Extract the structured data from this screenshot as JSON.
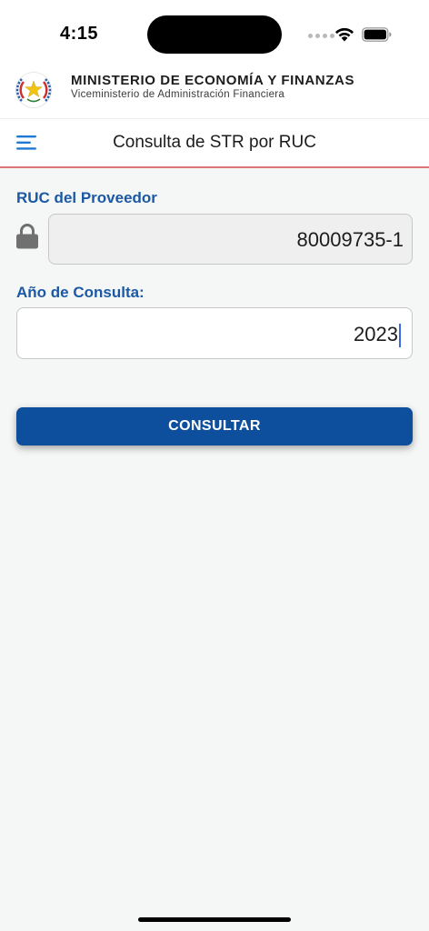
{
  "status_bar": {
    "time": "4:15",
    "icons": [
      "signal-icon",
      "wifi-icon",
      "battery-icon"
    ]
  },
  "header": {
    "logo": "seal-icon",
    "title": "MINISTERIO DE ECONOMÍA Y FINANZAS",
    "subtitle": "Viceministerio de Administración Financiera"
  },
  "nav": {
    "menu_icon": "menu-icon",
    "title": "Consulta de STR por RUC"
  },
  "form": {
    "ruc_label": "RUC del Proveedor",
    "ruc_value": "80009735-1",
    "ruc_locked": true,
    "lock_icon": "lock-icon",
    "anio_label": "Año de Consulta:",
    "anio_value": "2023",
    "submit_label": "CONSULTAR"
  },
  "colors": {
    "accent_blue": "#1b59a5",
    "button_blue": "#0d4f9d",
    "nav_divider": "#d9767a",
    "background": "#f5f6f6"
  }
}
